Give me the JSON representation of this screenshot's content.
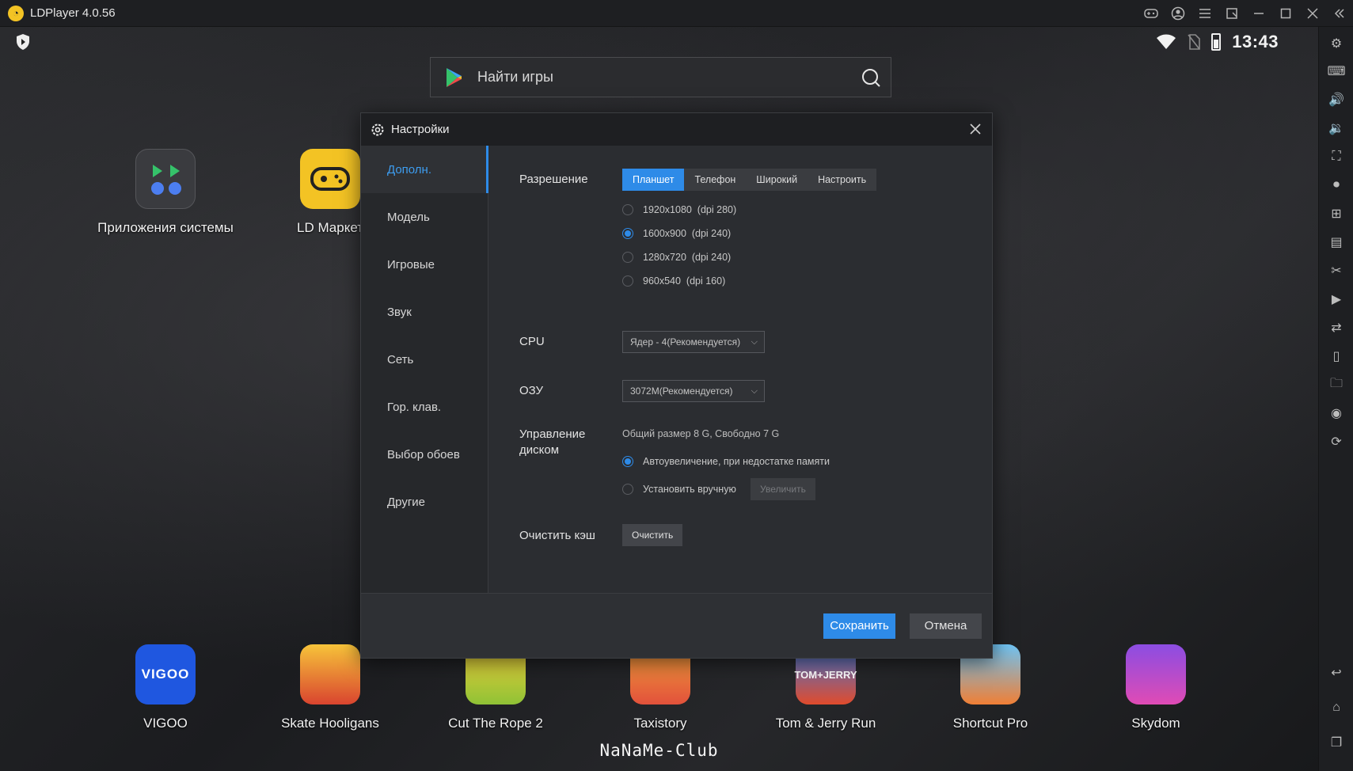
{
  "window": {
    "title": "LDPlayer 4.0.56"
  },
  "status_bar": {
    "time": "13:43"
  },
  "search": {
    "placeholder": "Найти игры"
  },
  "desktop_apps_top": [
    {
      "label": "Приложения системы",
      "icon": "system-apps-icon"
    },
    {
      "label": "LD Маркет",
      "icon": "ld-market-icon"
    }
  ],
  "desktop_apps_bottom": [
    {
      "label": "VIGOO",
      "icon": "vigoo-icon",
      "badge": "VIGOO"
    },
    {
      "label": "Skate Hooligans",
      "icon": "skate-hooligans-icon"
    },
    {
      "label": "Cut The Rope 2",
      "icon": "cut-the-rope-icon"
    },
    {
      "label": "Taxistory",
      "icon": "taxistory-icon"
    },
    {
      "label": "Tom & Jerry Run",
      "icon": "tom-jerry-icon",
      "badge": "TOM+JERRY"
    },
    {
      "label": "Shortcut Pro",
      "icon": "shortcut-pro-icon"
    },
    {
      "label": "Skydom",
      "icon": "skydom-icon"
    }
  ],
  "watermark": "NaNaMe-Club",
  "settings": {
    "title": "Настройки",
    "nav": [
      "Дополн.",
      "Модель",
      "Игровые",
      "Звук",
      "Сеть",
      "Гор. клав.",
      "Выбор обоев",
      "Другие"
    ],
    "active_nav": "Дополн.",
    "resolution": {
      "label": "Разрешение",
      "tabs": [
        "Планшет",
        "Телефон",
        "Широкий",
        "Настроить"
      ],
      "active_tab": "Планшет",
      "options": [
        "1920x1080  (dpi 280)",
        "1600x900  (dpi 240)",
        "1280x720  (dpi 240)",
        "960x540  (dpi 160)"
      ],
      "selected": "1600x900  (dpi 240)"
    },
    "cpu": {
      "label": "CPU",
      "value": "Ядер - 4(Рекомендуется)"
    },
    "ram": {
      "label": "ОЗУ",
      "value": "3072M(Рекомендуется)"
    },
    "disk": {
      "label_line1": "Управление",
      "label_line2": "диском",
      "info": "Общий размер 8 G,  Свободно 7 G",
      "option_auto": "Автоувеличение, при недостатке памяти",
      "option_manual": "Установить вручную",
      "increase_button": "Увеличить"
    },
    "cache": {
      "label": "Очистить кэш",
      "button": "Очистить"
    },
    "save": "Сохранить",
    "cancel": "Отмена"
  },
  "colors": {
    "accent": "#2e8be8",
    "dialog_bg": "#2b2d31",
    "titlebar_bg": "#1e1f22"
  }
}
